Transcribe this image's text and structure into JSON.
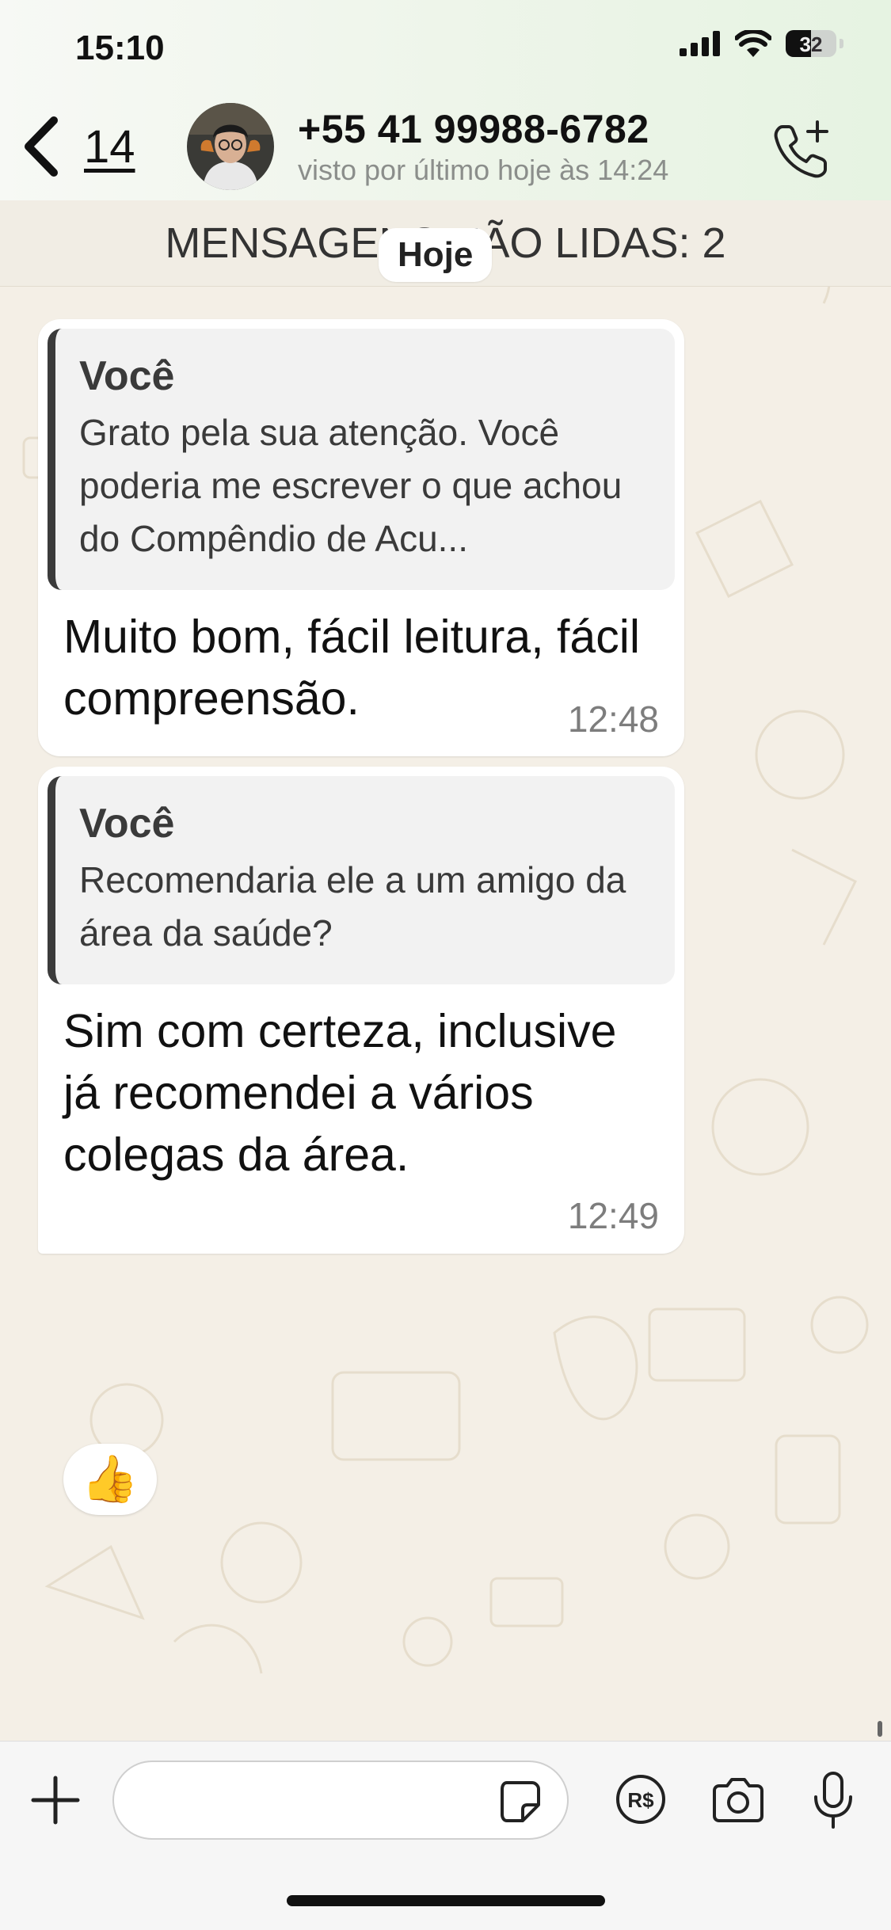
{
  "status_bar": {
    "time": "15:10",
    "battery_level": "32",
    "icons": [
      "cellular-signal-icon",
      "wifi-icon",
      "battery-icon"
    ]
  },
  "header": {
    "back_count": "14",
    "contact_name": "+55 41 99988-6782",
    "last_seen": "visto por último hoje às 14:24",
    "icons": [
      "back-chevron-icon",
      "add-call-icon"
    ]
  },
  "chat": {
    "unread_banner": "MENSAGENS NÃO LIDAS: 2",
    "day_label": "Hoje",
    "messages": [
      {
        "quote_author": "Você",
        "quote_text": "Grato pela sua atenção. Você poderia me escrever o que achou do Compêndio de Acu...",
        "text": "Muito bom, fácil leitura, fácil compreensão.",
        "time": "12:48"
      },
      {
        "quote_author": "Você",
        "quote_text": "Recomendaria ele a um amigo da área da saúde?",
        "text": "Sim com certeza, inclusive já recomendei a vários colegas da área.",
        "time": "12:49",
        "reaction": "👍"
      }
    ]
  },
  "input_bar": {
    "message_value": "",
    "icons": [
      "plus-icon",
      "sticker-icon",
      "payment-icon",
      "camera-icon",
      "microphone-icon"
    ]
  },
  "colors": {
    "chat_background": "#f4efe6",
    "header_background": "#eef5ea",
    "bubble": "#ffffff",
    "quote_bar": "#3b3b3b",
    "time_text": "#7d7d7d"
  }
}
